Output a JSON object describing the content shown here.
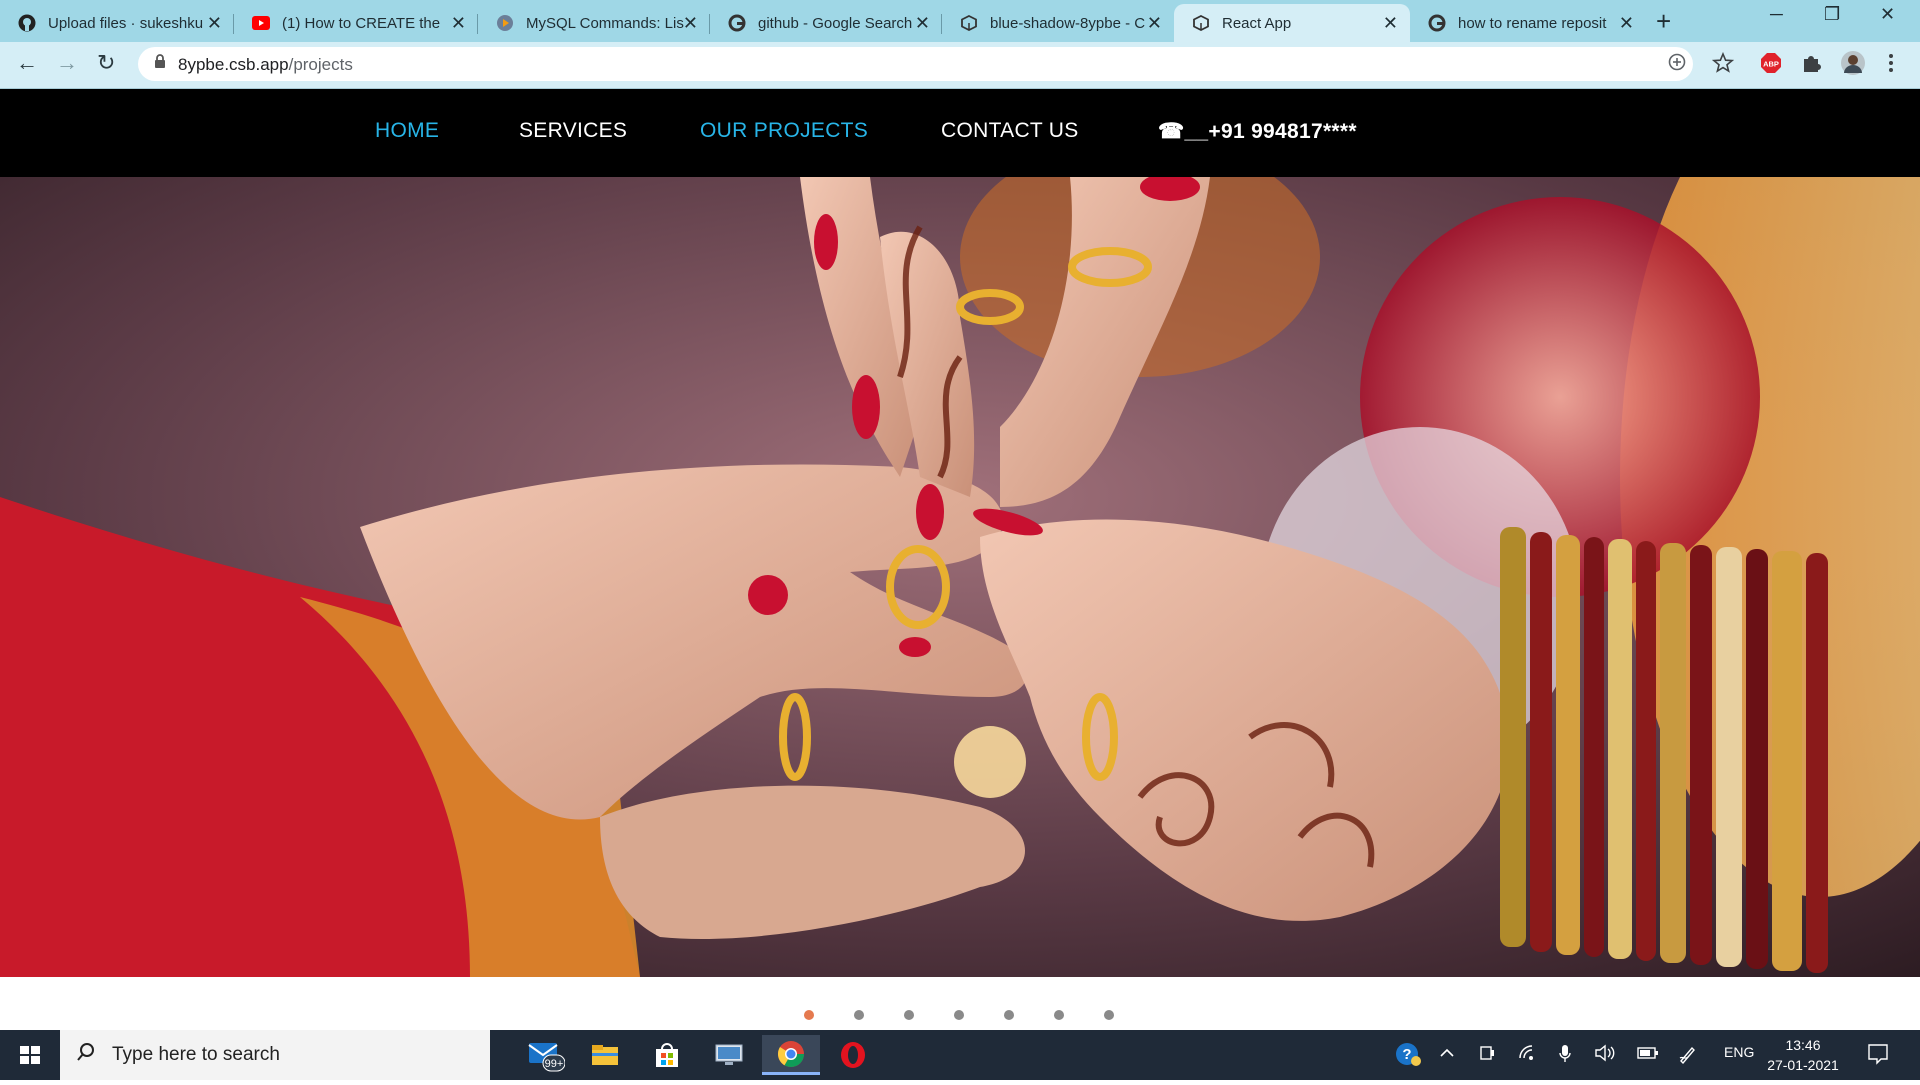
{
  "browser": {
    "tabs": [
      {
        "title": "Upload files · sukeshku",
        "favicon": "github-icon",
        "active": false
      },
      {
        "title": "(1) How to CREATE the",
        "favicon": "youtube-icon",
        "active": false
      },
      {
        "title": "MySQL Commands: Lis",
        "favicon": "play-icon",
        "active": false
      },
      {
        "title": "github - Google Search",
        "favicon": "google-icon",
        "active": false
      },
      {
        "title": "blue-shadow-8ypbe - C",
        "favicon": "codesandbox-icon",
        "active": false
      },
      {
        "title": "React App",
        "favicon": "codesandbox-icon",
        "active": true
      },
      {
        "title": "how to rename reposit",
        "favicon": "google-icon",
        "active": false
      }
    ],
    "close_glyph": "✕",
    "new_tab_glyph": "+",
    "window_controls": {
      "minimize": "─",
      "maximize": "❐",
      "close": "✕"
    },
    "address": {
      "domain": "8ypbe.csb.app",
      "path": "/projects"
    },
    "nav": {
      "back": "←",
      "forward": "→",
      "reload": "↻"
    },
    "extension_abp": "ABP"
  },
  "site": {
    "nav_items": [
      {
        "label": "HOME",
        "active": true
      },
      {
        "label": "SERVICES",
        "active": false
      },
      {
        "label": "OUR PROJECTS",
        "active": true
      },
      {
        "label": "CONTACT US",
        "active": false
      }
    ],
    "phone": "☎__+91 994817****",
    "hero_image": "wedding ring ceremony hands with henna",
    "carousel_dots": 7,
    "carousel_active_index": 0,
    "colors": {
      "nav_bg": "#000000",
      "nav_active": "#28b5e8",
      "dot_active": "#e57a4f"
    }
  },
  "taskbar": {
    "search_placeholder": "Type here to search",
    "mail_badge": "99+",
    "language": "ENG",
    "time": "13:46",
    "date": "27-01-2021"
  }
}
